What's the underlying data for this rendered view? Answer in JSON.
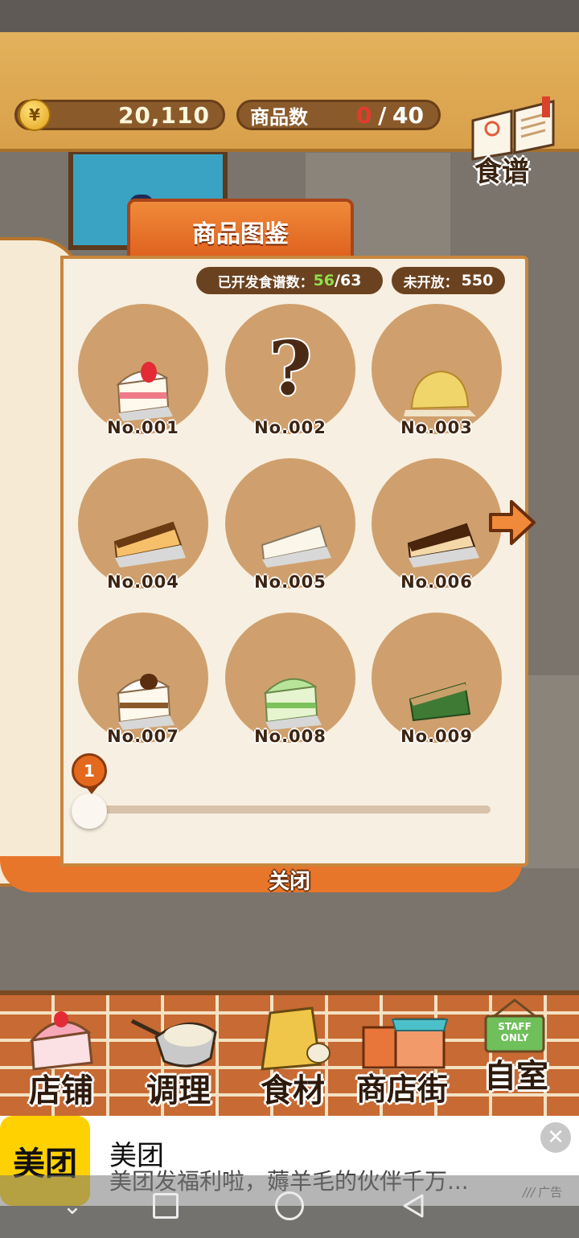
{
  "header": {
    "money": "20,110",
    "currency_symbol": "¥",
    "products_label": "商品数",
    "products_count": "0",
    "products_separator": "/",
    "products_total": "40",
    "recipe_label": "食谱"
  },
  "book": {
    "title": "商品图鉴",
    "developed_label": "已开发食谱数：",
    "developed_value": "56",
    "developed_total": "/63",
    "unopened_label": "未开放：",
    "unopened_value": "550",
    "items": [
      {
        "number": "No.001",
        "art": "strawberry-shortcake-icon"
      },
      {
        "number": "No.002",
        "art": "question-mark-icon"
      },
      {
        "number": "No.003",
        "art": "melon-bread-icon"
      },
      {
        "number": "No.004",
        "art": "cheesecake-icon"
      },
      {
        "number": "No.005",
        "art": "rare-cheesecake-icon"
      },
      {
        "number": "No.006",
        "art": "chocolate-cheesecake-icon"
      },
      {
        "number": "No.007",
        "art": "chestnut-shortcake-icon"
      },
      {
        "number": "No.008",
        "art": "matcha-shortcake-icon"
      },
      {
        "number": "No.009",
        "art": "matcha-cake-icon"
      }
    ],
    "page_indicator": "1",
    "page_progress": 0,
    "close_label": "关闭"
  },
  "nav": {
    "items": [
      {
        "label": "店铺",
        "icon": "cake-icon"
      },
      {
        "label": "调理",
        "icon": "mixing-bowl-icon"
      },
      {
        "label": "食材",
        "icon": "ingredient-bag-icon"
      },
      {
        "label": "商店街",
        "icon": "shop-street-icon"
      },
      {
        "label": "自室",
        "icon": "staff-door-icon"
      }
    ],
    "staff_sign": "STAFF ONLY"
  },
  "ad": {
    "logo_text": "美团",
    "title": "美团",
    "description": "美团发福利啦，薅羊毛的伙伴千万...",
    "tag": "广告",
    "close_icon": "close-icon"
  },
  "colors": {
    "accent": "#e3691f",
    "wood": "#8b5a2b",
    "page": "#f7efe1",
    "circle": "#cfa06d"
  }
}
